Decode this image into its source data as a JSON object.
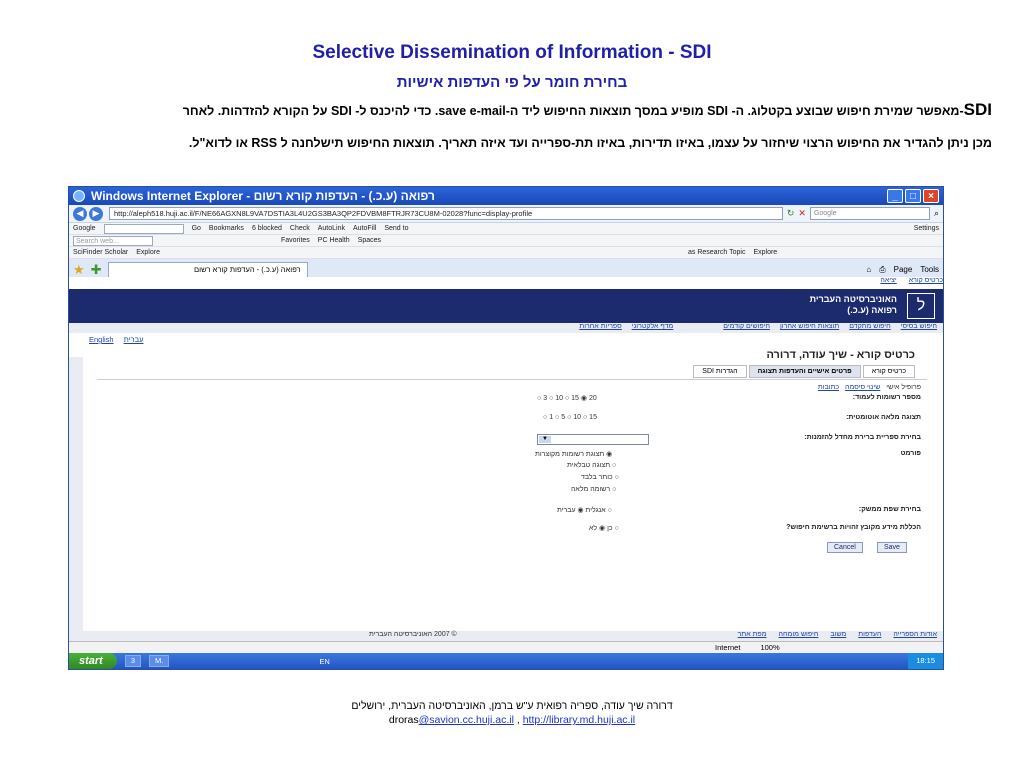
{
  "slide": {
    "title": "Selective Dissemination of Information  - SDI",
    "subtitle": "בחירת חומר על פי העדפות אישיות",
    "desc_big": "SDI",
    "desc1_rest": "-מאפשר שמירת חיפוש שבוצע בקטלוג. ה- SDI מופיע במסך תוצאות החיפוש ליד ה-save e-mail. כדי להיכנס ל- SDI על הקורא להזדהות. לאחר",
    "desc2": "מכן ניתן להגדיר את החיפוש הרצוי שיחזור על עצמו, באיזו תדירות, באיזו תת-ספרייה ועד איזה תאריך. תוצאות החיפוש תישלחנה ל  RSS  או לדוא\"ל.",
    "credit_line1": "דרורה שיך עודה, ספריה רפואית ע\"ש ברמן, האוניברסיטה העברית, ירושלים",
    "credit_email_prefix": "droras",
    "credit_email_link": "@savion.cc.huji.ac.il",
    "credit_sep": " , ",
    "credit_url": "http://library.md.huji.ac.il"
  },
  "browser": {
    "window_title": "רפואה (ע.כ.) - העדפות קורא רשום - Windows Internet Explorer",
    "url": "http://aleph518.huji.ac.il/F/NE66AGXN8L9VA7DSTIA3L4U2GS3BA3QP2FDVBM8FTRJR73CU8M-02028?func=display-profile",
    "search_placeholder": "Google",
    "toolbar1": [
      "Google",
      "Go",
      "Bookmarks",
      "6 blocked",
      "Check",
      "AutoLink",
      "AutoFill",
      "Send to",
      "Settings"
    ],
    "toolbar2": [
      "Search web...",
      "Favorites",
      "PC Health",
      "Spaces"
    ],
    "toolbar3": [
      "SciFinder Scholar",
      "Explore",
      "as Research Topic",
      "Explore"
    ],
    "tab_title": "רפואה (ע.כ.) - העדפות קורא רשום",
    "tab_tools": [
      "Page",
      "Tools"
    ]
  },
  "page": {
    "topnav": [
      "כרטיס קורא",
      "יציאה"
    ],
    "university": "האוניברסיטה העברית",
    "faculty": "רפואה (ע.כ.)",
    "menu1": [
      "חיפוש בסיסי",
      "חיפוש מתקדם",
      "תוצאות חיפוש אחרון",
      "חיפושים קודמים"
    ],
    "menu2": [
      "מדף אלקטרוני",
      "ספריות אחרות"
    ],
    "lang": [
      "English",
      "עברית"
    ],
    "card_title": "כרטיס קורא -  שיך עודה, דרורה",
    "subtabs": [
      "כרטיס קורא",
      "פרטים אישיים והעדפות תצוגה",
      "הגדרות SDI"
    ],
    "links": [
      "פרופיל אישי",
      "שינוי סיסמה",
      "כתובות"
    ],
    "labels": {
      "records": "מספר רשומות לעמוד:",
      "full_view": "תצוגה מלאה אוטומטית:",
      "library": "בחירת ספריית ברירת מחדל להזמנות:",
      "format": "פורמט",
      "language": "בחירת שפת ממשק:",
      "identity": "הכללת מידע מקובץ זהויות ברשימת חיפוש?"
    },
    "records_opts": "20 ◉ 15 ○ 10 ○ 3 ○",
    "full_opts": "15 ○ 10 ○ 5 ○ 1 ○",
    "format_opts": [
      "◉ תצוגת רשומות מקוצרות",
      "○ תצוגה טבלאית",
      "○ כותר בלבד",
      "○ רשומה מלאה"
    ],
    "language_opts": "○ אנגלית ◉ עברית",
    "identity_opts": "○ כן ◉ לא",
    "cancel": "Cancel",
    "save": "Save",
    "footer": [
      "אודות הספרייה",
      "העדפות",
      "משוב",
      "חיפוש מומחה",
      "מפת אתר"
    ],
    "copyright": "© 2007 האוניברסיטה העברית"
  },
  "status": {
    "zone": "Internet",
    "zoom": "100%",
    "start": "start",
    "tasks": [
      "3",
      "M."
    ],
    "lang": "EN",
    "clock": "18:15"
  }
}
